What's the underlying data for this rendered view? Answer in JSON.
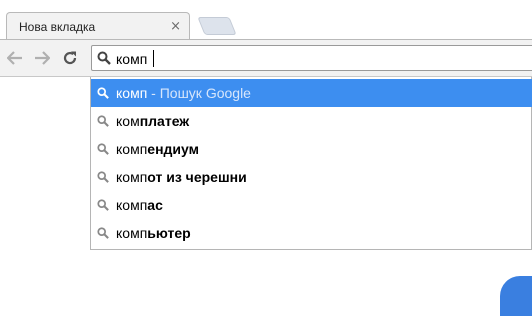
{
  "tab": {
    "title": "Нова вкладка",
    "close_glyph": "×"
  },
  "toolbar": {
    "back_icon": "back-arrow-icon",
    "forward_icon": "forward-arrow-icon",
    "reload_icon": "reload-icon"
  },
  "omnibox": {
    "icon": "search-icon",
    "value": "комп"
  },
  "suggestions": [
    {
      "prefix": "комп",
      "suffix": "",
      "hint": " - Пошук Google",
      "selected": true
    },
    {
      "prefix": "ком",
      "suffix": "платеж",
      "hint": "",
      "selected": false
    },
    {
      "prefix": "комп",
      "suffix": "ендиум",
      "hint": "",
      "selected": false
    },
    {
      "prefix": "комп",
      "suffix": "от из черешни",
      "hint": "",
      "selected": false
    },
    {
      "prefix": "комп",
      "suffix": "ас",
      "hint": "",
      "selected": false
    },
    {
      "prefix": "комп",
      "suffix": "ьютер",
      "hint": "",
      "selected": false
    }
  ],
  "colors": {
    "selection": "#3d8ef0",
    "accent_blue": "#3a7fe0"
  }
}
